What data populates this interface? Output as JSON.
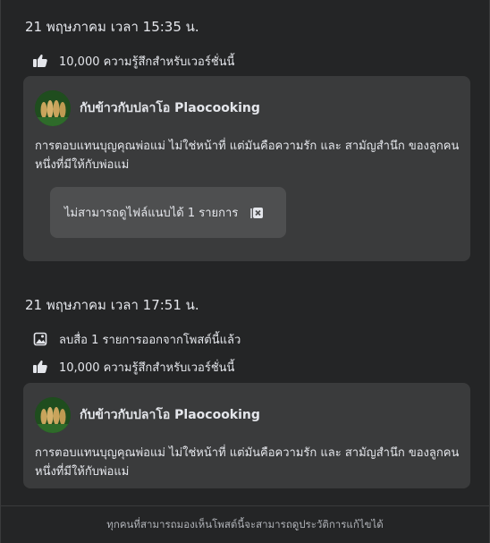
{
  "entries": [
    {
      "date": "21 พฤษภาคม เวลา 15:35 น.",
      "reactions": "10,000 ความรู้สึกสำหรับเวอร์ชั่นนี้",
      "post": {
        "author": "กับข้าวกับปลาโอ Plaocooking",
        "text": "การตอบแทนบุญคุณพ่อแม่ ไม่ใช่หน้าที่ แต่มันคือความรัก และ สามัญสำนึก ของลูกคนหนึ่งที่มีให้กับพ่อแม่",
        "attachment_notice": "ไม่สามารถดูไฟล์แนบได้ 1 รายการ"
      }
    },
    {
      "date": "21 พฤษภาคม เวลา 17:51 น.",
      "media_change": "ลบสื่อ 1 รายการออกจากโพสต์นี้แล้ว",
      "reactions": "10,000 ความรู้สึกสำหรับเวอร์ชั่นนี้",
      "post": {
        "author": "กับข้าวกับปลาโอ Plaocooking",
        "text": "การตอบแทนบุญคุณพ่อแม่ ไม่ใช่หน้าที่ แต่มันคือความรัก และ สามัญสำนึก ของลูกคนหนึ่งที่มีให้กับพ่อแม่"
      }
    }
  ],
  "footer": "ทุกคนที่สามารถมองเห็นโพสต์นี้จะสามารถดูประวัติการแก้ไขได้",
  "icons": {
    "like": "thumbs-up-icon",
    "media": "photo-removed-icon",
    "attachment": "unavailable-attachment-icon"
  },
  "colors": {
    "background": "#242526",
    "card": "#3a3b3c",
    "attachment": "#4e4f50",
    "text": "#e4e6eb",
    "secondary_text": "#b0b3b8"
  }
}
